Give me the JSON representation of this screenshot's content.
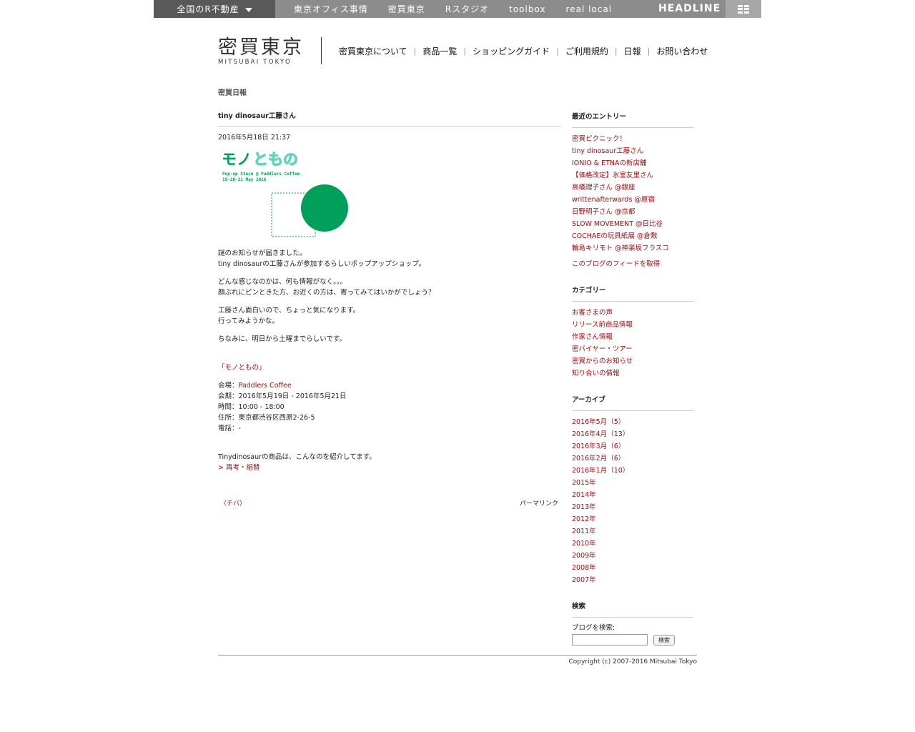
{
  "topbar": {
    "realestate_label": "全国のR不動産",
    "links": [
      "東京オフィス事情",
      "密買東京",
      "Rスタジオ",
      "toolbox",
      "real local"
    ],
    "headline": "HEADLINE"
  },
  "header": {
    "logo_kanji": "密買東京",
    "logo_roman": "MITSUBAI TOKYO",
    "nav": [
      "密買東京について",
      "商品一覧",
      "ショッピングガイド",
      "ご利用規約",
      "日報",
      "お問い合わせ"
    ]
  },
  "section_title": "密買日報",
  "post": {
    "title": "tiny dinosaur工藤さん",
    "date": "2016年5月18日 21:37",
    "image": {
      "title_part1": "モノ",
      "title_part2": "ともの",
      "line1": "Pop-up Store @ Paddlers Coffee",
      "line2": "19-20-21 May 2016",
      "colors": {
        "green": "#00a05a",
        "light": "#5fd3c0"
      }
    },
    "p1a": "謎のお知らせが届きました。",
    "p1b": "tiny dinosaurの工藤さんが参加するらしいポップアップショップ。",
    "p2a": "どんな感じなのかは、何も情報がなく。。。",
    "p2b": "顔ぶれにピンときた方、お近くの方は、寄ってみてはいかがでしょう？",
    "p3a": "工藤さん面白いので、ちょっと気になります。",
    "p3b": "行ってみようかな。",
    "p4": "ちなみに、明日から土曜までらしいです。",
    "event_link": "「モノともの」",
    "venue_label": "会場：",
    "venue_link": "Paddlers Coffee",
    "period": "会期：2016年5月19日 - 2016年5月21日",
    "time": "時間：10:00 - 18:00",
    "address": "住所：東京都渋谷区西原2-26-5",
    "phone": "電話：-",
    "intro": "Tinydinosaurの商品は、こんなのを紹介してます。",
    "product_link": "> 再考・組替",
    "author": "（チバ）",
    "permalink": "パーマリンク"
  },
  "sidebar": {
    "recent_title": "最近のエントリー",
    "recent": [
      "密買ピクニック！",
      "tiny dinosaur工藤さん",
      "IONIO & ETNAの新店舗",
      "【価格改定】氷室友里さん",
      "高橋理子さん @銀座",
      "writtenafterwards @原宿",
      "日野明子さん @京都",
      "SLOW MOVEMENT @日比谷",
      "COCHAEの玩具紙展 @倉敷",
      "輪島キリモト @神楽坂フラスコ"
    ],
    "feed_link": "このブログのフィードを取得",
    "category_title": "カテゴリー",
    "categories": [
      "お客さまの声",
      "リリース前商品情報",
      "作家さん情報",
      "密バイヤー・ツアー",
      "密買からのお知らせ",
      "知り合いの情報"
    ],
    "archive_title": "アーカイブ",
    "archives": [
      "2016年5月（5）",
      "2016年4月（13）",
      "2016年3月（6）",
      "2016年2月（6）",
      "2016年1月（10）",
      "2015年",
      "2014年",
      "2013年",
      "2012年",
      "2011年",
      "2010年",
      "2009年",
      "2008年",
      "2007年"
    ],
    "search_title": "検索",
    "search_label": "ブログを検索:",
    "search_value": "",
    "search_button": "検索"
  },
  "footer": {
    "copyright": "Copyright (c) 2007-2016 Mitsubai Tokyo"
  }
}
